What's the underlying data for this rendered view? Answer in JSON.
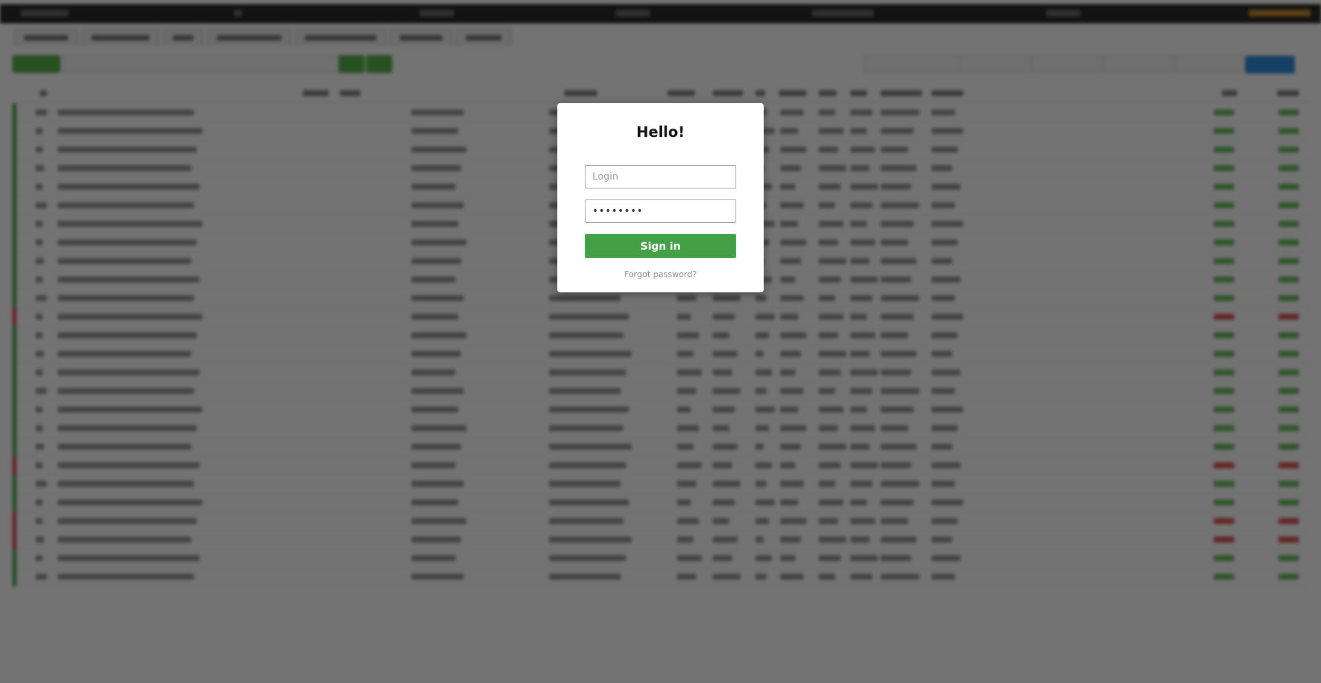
{
  "login_modal": {
    "title": "Hello!",
    "login_placeholder": "Login",
    "password_value": "••••••••",
    "sign_in_label": "Sign in",
    "forgot_password_label": "Forgot password?"
  },
  "colors": {
    "sign_in_button": "#43a047",
    "overlay": "rgba(0,0,0,0.55)",
    "profit_positive": "#6fbf62",
    "profit_negative": "#e05a5a",
    "accent_blue": "#2f8fdc"
  },
  "background_table": {
    "row_status": [
      "up",
      "up",
      "up",
      "up",
      "up",
      "up",
      "up",
      "up",
      "up",
      "up",
      "up",
      "down",
      "up",
      "up",
      "up",
      "up",
      "up",
      "up",
      "up",
      "down",
      "up",
      "up",
      "down",
      "down",
      "up",
      "up"
    ]
  }
}
